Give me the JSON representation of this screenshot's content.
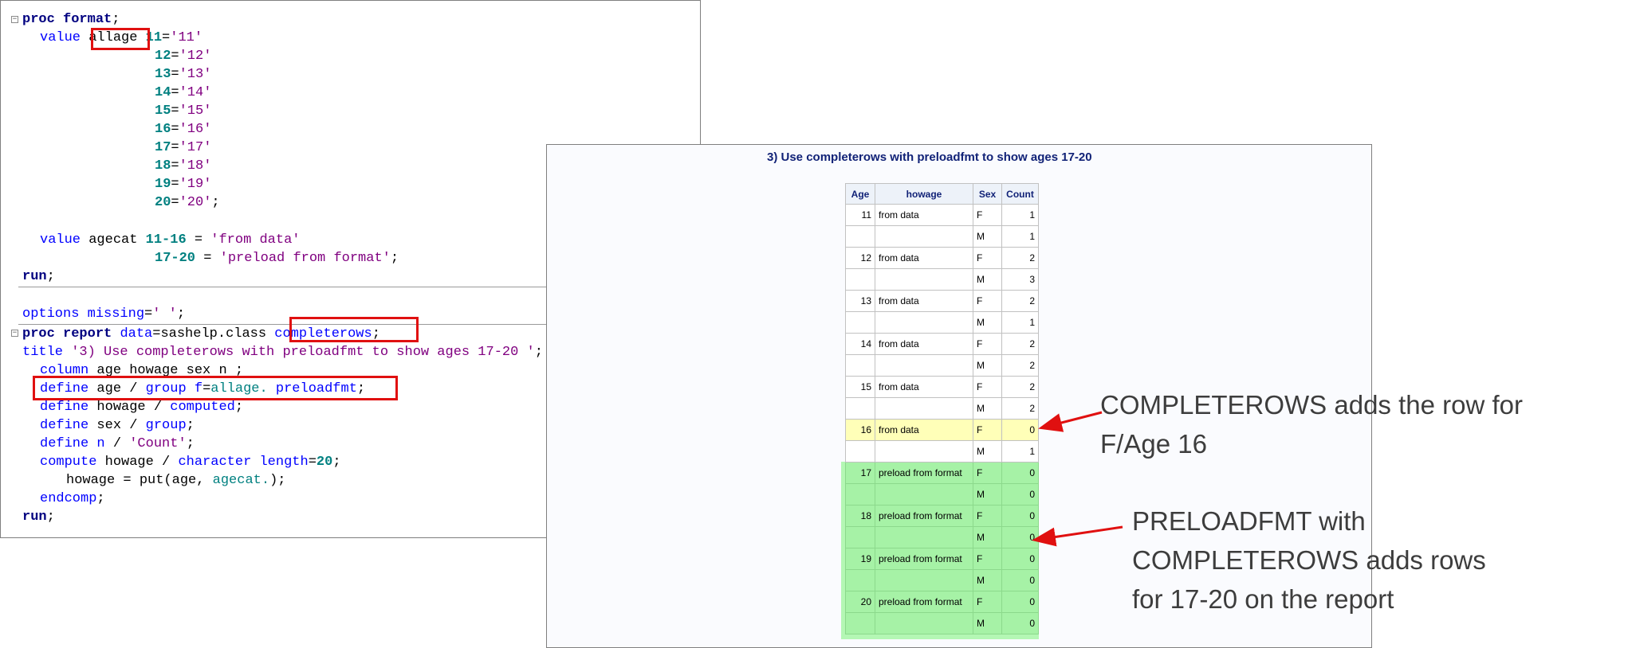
{
  "code": {
    "lines": [
      [
        "proc format;"
      ],
      [
        "value allage 11='11'"
      ],
      [
        "12='12'"
      ],
      [
        "13='13'"
      ],
      [
        "14='14'"
      ],
      [
        "15='15'"
      ],
      [
        "16='16'"
      ],
      [
        "17='17'"
      ],
      [
        "18='18'"
      ],
      [
        "19='19'"
      ],
      [
        "20='20';"
      ],
      [
        "value agecat 11-16 = 'from data'"
      ],
      [
        "17-20 = 'preload from format';"
      ],
      [
        "run;"
      ],
      [
        "options missing=' ';"
      ],
      [
        "proc report data=sashelp.class completerows;"
      ],
      [
        "title '3) Use completerows with preloadfmt to show ages 17-20 ';"
      ],
      [
        "column age howage sex n ;"
      ],
      [
        "define age / group f=allage. preloadfmt;"
      ],
      [
        "define howage / computed;"
      ],
      [
        "define sex / group;"
      ],
      [
        "define n / 'Count';"
      ],
      [
        "compute howage / character length=20;"
      ],
      [
        "howage = put(age, agecat.);"
      ],
      [
        "endcomp;"
      ],
      [
        "run;"
      ]
    ],
    "tokens": {
      "proc": "proc",
      "format": "format",
      "value": "value",
      "allage": "allage",
      "agecat": "agecat",
      "run": "run",
      "options": "options",
      "missing": "missing",
      "report": "report",
      "data_kw": "data",
      "sashelp_class": "sashelp.class",
      "completerows": "completerows",
      "title": "title",
      "title_str": "'3) Use completerows with preloadfmt to show ages 17-20 '",
      "column": "column",
      "column_vars": "age howage sex n",
      "define": "define",
      "age": "age",
      "group": "group",
      "f": "f",
      "allage_fmt": "allage.",
      "preloadfmt": "preloadfmt",
      "howage": "howage",
      "computed": "computed",
      "sex": "sex",
      "n": "n",
      "count_str": "'Count'",
      "compute": "compute",
      "character": "character",
      "length": "length",
      "twenty": "20",
      "put_expr_a": "howage = put(age, ",
      "agecat_fmt": "agecat.",
      "put_expr_b": ");",
      "endcomp": "endcomp",
      "missing_str": "' '",
      "from_data": "'from data'",
      "preload_from_format": "'preload from format'",
      "range1": "11-16",
      "range2": "17-20",
      "fmt_pairs": [
        {
          "num": "11",
          "str": "'11'"
        },
        {
          "num": "12",
          "str": "'12'"
        },
        {
          "num": "13",
          "str": "'13'"
        },
        {
          "num": "14",
          "str": "'14'"
        },
        {
          "num": "15",
          "str": "'15'"
        },
        {
          "num": "16",
          "str": "'16'"
        },
        {
          "num": "17",
          "str": "'17'"
        },
        {
          "num": "18",
          "str": "'18'"
        },
        {
          "num": "19",
          "str": "'19'"
        },
        {
          "num": "20",
          "str": "'20'"
        }
      ]
    }
  },
  "report": {
    "title": "3) Use completerows with preloadfmt to show ages 17-20",
    "columns": [
      "Age",
      "howage",
      "Sex",
      "Count"
    ],
    "rows": [
      {
        "age": "11",
        "howage": "from data",
        "sex": "F",
        "count": "1",
        "hl": ""
      },
      {
        "age": "",
        "howage": "",
        "sex": "M",
        "count": "1",
        "hl": ""
      },
      {
        "age": "12",
        "howage": "from data",
        "sex": "F",
        "count": "2",
        "hl": ""
      },
      {
        "age": "",
        "howage": "",
        "sex": "M",
        "count": "3",
        "hl": ""
      },
      {
        "age": "13",
        "howage": "from data",
        "sex": "F",
        "count": "2",
        "hl": ""
      },
      {
        "age": "",
        "howage": "",
        "sex": "M",
        "count": "1",
        "hl": ""
      },
      {
        "age": "14",
        "howage": "from data",
        "sex": "F",
        "count": "2",
        "hl": ""
      },
      {
        "age": "",
        "howage": "",
        "sex": "M",
        "count": "2",
        "hl": ""
      },
      {
        "age": "15",
        "howage": "from data",
        "sex": "F",
        "count": "2",
        "hl": ""
      },
      {
        "age": "",
        "howage": "",
        "sex": "M",
        "count": "2",
        "hl": ""
      },
      {
        "age": "16",
        "howage": "from data",
        "sex": "F",
        "count": "0",
        "hl": "yellow"
      },
      {
        "age": "",
        "howage": "",
        "sex": "M",
        "count": "1",
        "hl": ""
      },
      {
        "age": "17",
        "howage": "preload from format",
        "sex": "F",
        "count": "0",
        "hl": "green"
      },
      {
        "age": "",
        "howage": "",
        "sex": "M",
        "count": "0",
        "hl": "green"
      },
      {
        "age": "18",
        "howage": "preload from format",
        "sex": "F",
        "count": "0",
        "hl": "green"
      },
      {
        "age": "",
        "howage": "",
        "sex": "M",
        "count": "0",
        "hl": "green"
      },
      {
        "age": "19",
        "howage": "preload from format",
        "sex": "F",
        "count": "0",
        "hl": "green"
      },
      {
        "age": "",
        "howage": "",
        "sex": "M",
        "count": "0",
        "hl": "green"
      },
      {
        "age": "20",
        "howage": "preload from format",
        "sex": "F",
        "count": "0",
        "hl": "green"
      },
      {
        "age": "",
        "howage": "",
        "sex": "M",
        "count": "0",
        "hl": "green"
      }
    ]
  },
  "annotations": {
    "completerows_note": "COMPLETEROWS adds the row for\nF/Age 16",
    "preloadfmt_note": "PRELOADFMT with\nCOMPLETEROWS adds rows\nfor 17-20 on the report"
  },
  "colors": {
    "highlight_box": "#e01010",
    "arrow": "#e01010",
    "yellow_row": "#ffffb8",
    "green_rows": "#a6f2a6",
    "keyword_blue": "#0000ff",
    "string_purple": "#800080",
    "number_teal": "#008080",
    "header_navy": "#112277"
  }
}
